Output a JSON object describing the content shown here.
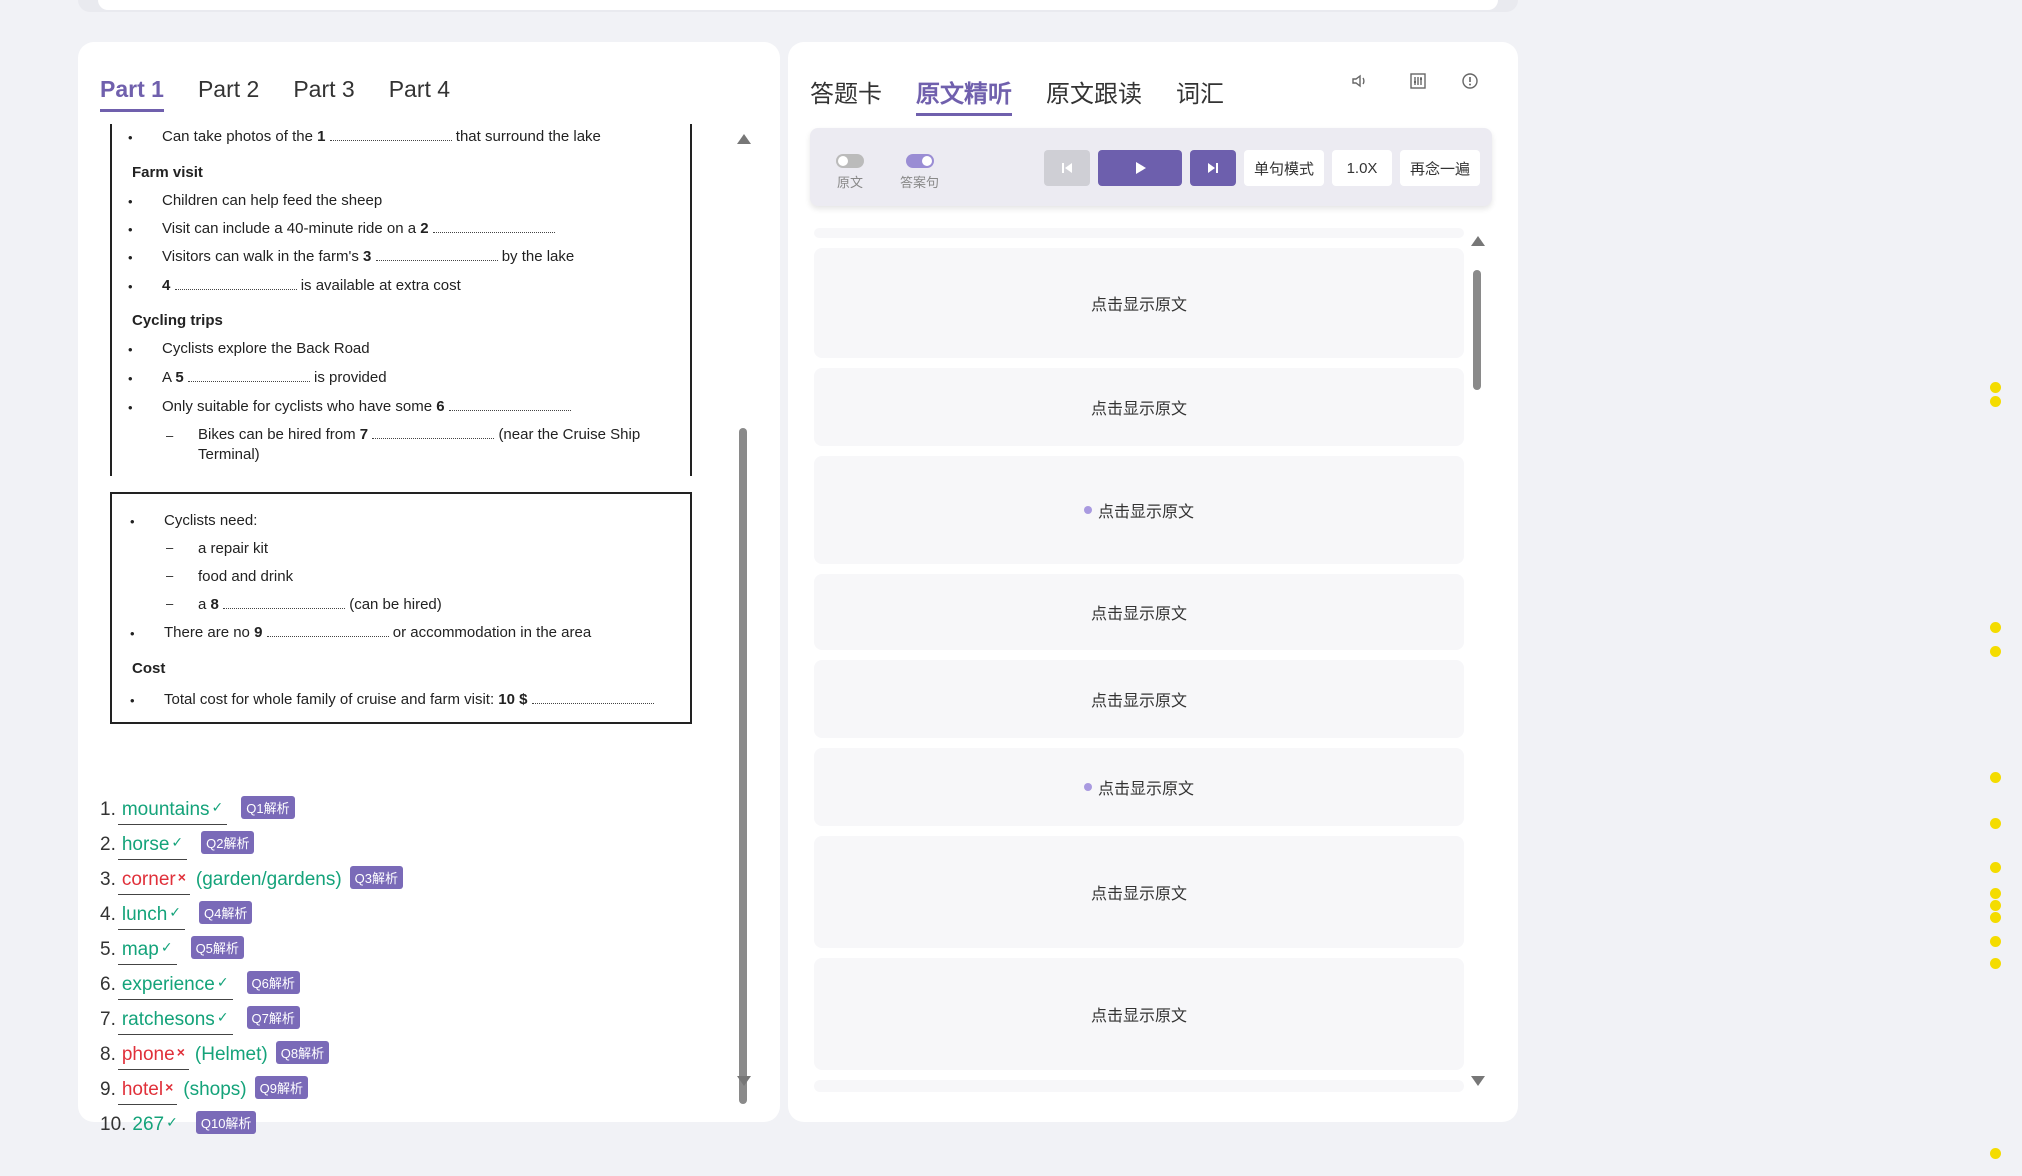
{
  "left_tabs": [
    "Part 1",
    "Part 2",
    "Part 3",
    "Part 4"
  ],
  "document": {
    "line_lake_pre": "Can take photos of the",
    "line_lake_q": "1",
    "line_lake_post": "that surround the lake",
    "farm_heading": "Farm visit",
    "farm_1": "Children can help feed the sheep",
    "farm_2_pre": "Visit can include a 40-minute ride on a",
    "farm_2_q": "2",
    "farm_3_pre": "Visitors can walk in the farm's",
    "farm_3_q": "3",
    "farm_3_post": "by the lake",
    "farm_4_q": "4",
    "farm_4_post": "is available at extra cost",
    "cycling_heading": "Cycling trips",
    "cyc_1": "Cyclists explore the Back Road",
    "cyc_2_pre": "A",
    "cyc_2_q": "5",
    "cyc_2_post": "is provided",
    "cyc_3_pre": "Only suitable for cyclists who have some",
    "cyc_3_q": "6",
    "cyc_4_pre": "Bikes can be hired from",
    "cyc_4_q": "7",
    "cyc_4_post": "(near the Cruise Ship",
    "cyc_4_post2": "Terminal)",
    "need_heading": "Cyclists need:",
    "need_1": "a repair kit",
    "need_2": "food and drink",
    "need_3_pre": "a",
    "need_3_q": "8",
    "need_3_post": "(can be hired)",
    "no_pre": "There are no",
    "no_q": "9",
    "no_post": "or accommodation in the area",
    "cost_heading": "Cost",
    "cost_pre": "Total cost for whole family of cruise and farm visit:",
    "cost_q": "10 $",
    "bullet": "•",
    "dash": "–"
  },
  "answers": [
    {
      "num": "1.",
      "word": "mountains",
      "status": "correct",
      "mark": "✓",
      "correction": "",
      "badge": "Q1解析"
    },
    {
      "num": "2.",
      "word": "horse",
      "status": "correct",
      "mark": "✓",
      "correction": "",
      "badge": "Q2解析"
    },
    {
      "num": "3.",
      "word": "corner",
      "status": "wrong",
      "mark": "×",
      "correction": "(garden/gardens)",
      "badge": "Q3解析"
    },
    {
      "num": "4.",
      "word": "lunch",
      "status": "correct",
      "mark": "✓",
      "correction": "",
      "badge": "Q4解析"
    },
    {
      "num": "5.",
      "word": "map",
      "status": "correct",
      "mark": "✓",
      "correction": "",
      "badge": "Q5解析"
    },
    {
      "num": "6.",
      "word": "experience",
      "status": "correct",
      "mark": "✓",
      "correction": "",
      "badge": "Q6解析"
    },
    {
      "num": "7.",
      "word": "ratchesons",
      "status": "correct",
      "mark": "✓",
      "correction": "",
      "badge": "Q7解析"
    },
    {
      "num": "8.",
      "word": "phone",
      "status": "wrong",
      "mark": "×",
      "correction": "(Helmet)",
      "badge": "Q8解析"
    },
    {
      "num": "9.",
      "word": "hotel",
      "status": "wrong",
      "mark": "×",
      "correction": "(shops)",
      "badge": "Q9解析"
    },
    {
      "num": "10.",
      "word": "267",
      "status": "correct",
      "mark": "✓",
      "correction": "",
      "badge": "Q10解析"
    }
  ],
  "right_tabs": [
    "答题卡",
    "原文精听",
    "原文跟读",
    "词汇"
  ],
  "toolbar_icons": [
    "volume-icon",
    "equalizer-icon",
    "info-icon"
  ],
  "player": {
    "toggle_original": "原文",
    "toggle_answer": "答案句",
    "mode_label": "单句模式",
    "speed_label": "1.0X",
    "repeat_label": "再念一遍",
    "prev_icon": "skip-previous-icon",
    "play_icon": "play-icon",
    "next_icon": "skip-next-icon"
  },
  "sentences": [
    {
      "label": "点击显示原文",
      "marked": false
    },
    {
      "label": "点击显示原文",
      "marked": false
    },
    {
      "label": "点击显示原文",
      "marked": true
    },
    {
      "label": "点击显示原文",
      "marked": false
    },
    {
      "label": "点击显示原文",
      "marked": false
    },
    {
      "label": "点击显示原文",
      "marked": true
    },
    {
      "label": "点击显示原文",
      "marked": false
    },
    {
      "label": "点击显示原文",
      "marked": false
    }
  ],
  "colors": {
    "accent": "#7060ad",
    "correct": "#14a37a",
    "wrong": "#e0303a",
    "badge": "#7a6ab8",
    "highlight_dot": "#f4dc00"
  }
}
